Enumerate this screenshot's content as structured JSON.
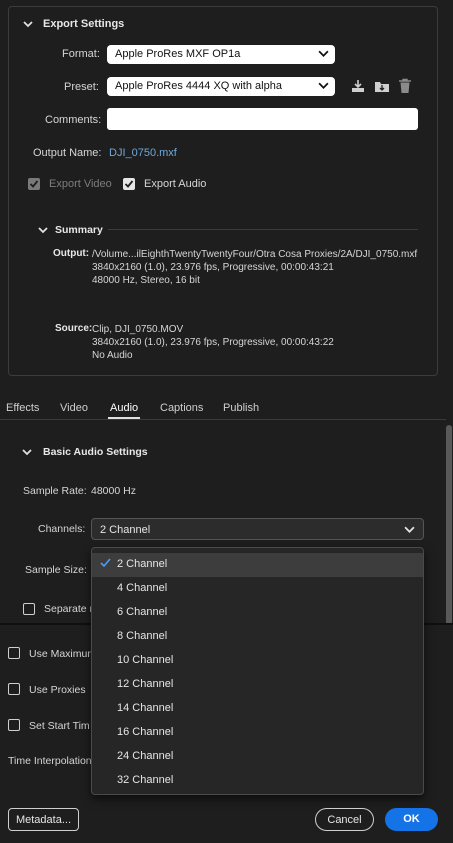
{
  "export_settings": {
    "title": "Export Settings",
    "format_label": "Format:",
    "format_value": "Apple ProRes MXF OP1a",
    "preset_label": "Preset:",
    "preset_value": "Apple ProRes 4444 XQ with alpha",
    "comments_label": "Comments:",
    "comments_value": "",
    "output_name_label": "Output Name:",
    "output_name_value": "DJI_0750.mxf",
    "export_video_label": "Export Video",
    "export_video_checked": true,
    "export_audio_label": "Export Audio",
    "export_audio_checked": true
  },
  "summary": {
    "title": "Summary",
    "output_label": "Output:",
    "output_lines": [
      "/Volume...ilEighthTwentyTwentyFour/Otra Cosa Proxies/2A/DJI_0750.mxf",
      "3840x2160 (1.0), 23.976 fps, Progressive, 00:00:43:21",
      "48000 Hz, Stereo, 16 bit"
    ],
    "source_label": "Source:",
    "source_lines": [
      "Clip, DJI_0750.MOV",
      "3840x2160 (1.0), 23.976 fps, Progressive, 00:00:43:22",
      "No Audio"
    ]
  },
  "tabs": [
    {
      "label": "Effects",
      "active": false
    },
    {
      "label": "Video",
      "active": false
    },
    {
      "label": "Audio",
      "active": true
    },
    {
      "label": "Captions",
      "active": false
    },
    {
      "label": "Publish",
      "active": false
    }
  ],
  "audio": {
    "section_title": "Basic Audio Settings",
    "sample_rate_label": "Sample Rate:",
    "sample_rate_value": "48000 Hz",
    "channels_label": "Channels:",
    "channels_value": "2 Channel",
    "sample_size_label": "Sample Size:",
    "separate_label": "Separate m"
  },
  "channel_menu": {
    "options": [
      "2 Channel",
      "4 Channel",
      "6 Channel",
      "8 Channel",
      "10 Channel",
      "12 Channel",
      "14 Channel",
      "16 Channel",
      "24 Channel",
      "32 Channel"
    ],
    "selected": "2 Channel"
  },
  "bottom_options": {
    "use_maximum_label": "Use Maximum",
    "use_proxies_label": "Use Proxies",
    "set_start_label": "Set Start Tim",
    "time_interpolation_label": "Time Interpolation"
  },
  "footer": {
    "metadata_label": "Metadata...",
    "cancel_label": "Cancel",
    "ok_label": "OK"
  },
  "colors": {
    "accent": "#1473e6",
    "link": "#6fa8dc",
    "background": "#1e1e1e"
  }
}
